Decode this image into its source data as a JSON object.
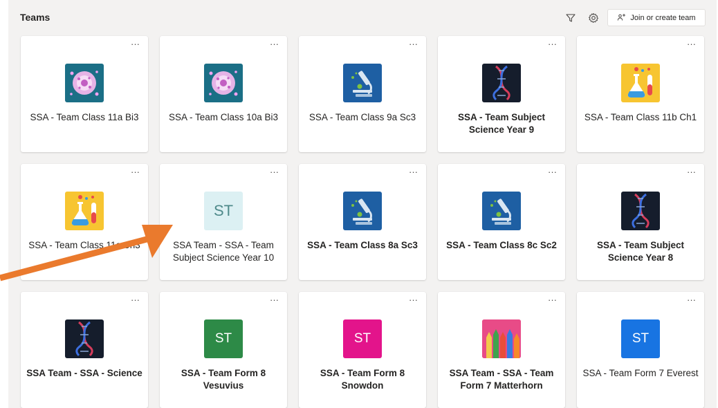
{
  "header": {
    "title": "Teams",
    "join_label": "Join or create team"
  },
  "icons": {
    "filter": "filter-icon",
    "settings": "gear-icon",
    "join": "people-add-icon",
    "more": "more-options-icon"
  },
  "more_label": "···",
  "teams": [
    {
      "name": "SSA - Team Class 11a Bi3",
      "bold": false,
      "avatar": {
        "type": "image",
        "icon": "bacteria-icon",
        "bg": "#1b6f86"
      }
    },
    {
      "name": "SSA - Team Class 10a Bi3",
      "bold": false,
      "avatar": {
        "type": "image",
        "icon": "bacteria-icon",
        "bg": "#1b6f86"
      }
    },
    {
      "name": "SSA - Team Class 9a Sc3",
      "bold": false,
      "avatar": {
        "type": "image",
        "icon": "microscope-icon",
        "bg": "#1e5fa3"
      }
    },
    {
      "name": "SSA - Team Subject Science Year 9",
      "bold": true,
      "avatar": {
        "type": "image",
        "icon": "dna-icon",
        "bg": "#151d2c"
      }
    },
    {
      "name": "SSA - Team Class 11b Ch1",
      "bold": false,
      "avatar": {
        "type": "image",
        "icon": "flask-icon",
        "bg": "#f7c531"
      }
    },
    {
      "name": "SSA - Team Class 11c Ch3",
      "bold": false,
      "avatar": {
        "type": "image",
        "icon": "flask-icon",
        "bg": "#f7c531"
      }
    },
    {
      "name": "SSA Team - SSA - Team Subject Science Year 10",
      "bold": false,
      "avatar": {
        "type": "initials",
        "text": "ST",
        "bg": "#dcf0f3"
      }
    },
    {
      "name": "SSA - Team Class 8a Sc3",
      "bold": true,
      "avatar": {
        "type": "image",
        "icon": "microscope-icon",
        "bg": "#1e5fa3"
      }
    },
    {
      "name": "SSA - Team Class 8c Sc2",
      "bold": true,
      "avatar": {
        "type": "image",
        "icon": "microscope-icon",
        "bg": "#1e5fa3"
      }
    },
    {
      "name": "SSA - Team Subject Science Year 8",
      "bold": true,
      "avatar": {
        "type": "image",
        "icon": "dna-icon",
        "bg": "#151d2c"
      }
    },
    {
      "name": "SSA Team - SSA - Science",
      "bold": true,
      "avatar": {
        "type": "image",
        "icon": "dna-icon",
        "bg": "#151d2c"
      }
    },
    {
      "name": "SSA - Team Form 8 Vesuvius",
      "bold": true,
      "avatar": {
        "type": "initials",
        "text": "ST",
        "bg": "#2d8a47"
      }
    },
    {
      "name": "SSA - Team Form 8 Snowdon",
      "bold": true,
      "avatar": {
        "type": "initials",
        "text": "ST",
        "bg": "#e3148b"
      }
    },
    {
      "name": "SSA Team - SSA - Team Form 7 Matterhorn",
      "bold": true,
      "avatar": {
        "type": "image",
        "icon": "pencils-icon",
        "bg": "#e84b87"
      }
    },
    {
      "name": "SSA - Team Form 7 Everest",
      "bold": false,
      "avatar": {
        "type": "initials",
        "text": "ST",
        "bg": "#1874e2"
      }
    }
  ],
  "colors": {
    "accent_arrow": "#ea7a2d"
  }
}
